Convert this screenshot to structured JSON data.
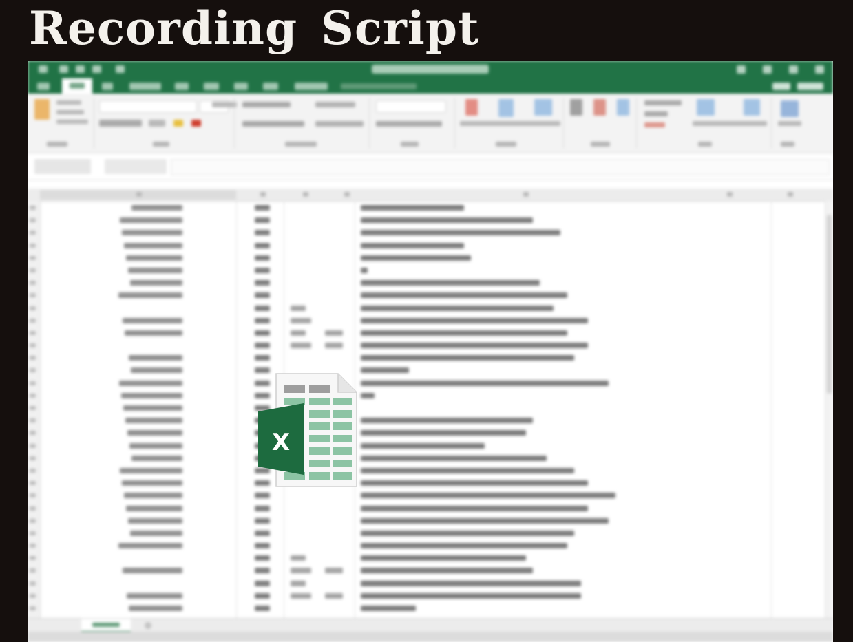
{
  "slide": {
    "title": "Recording Script"
  },
  "app": {
    "name": "Microsoft Excel",
    "icon_letter": "X"
  },
  "colors": {
    "excel_green": "#217346",
    "slide_background": "#150f0d",
    "title_text": "#f4f1ec"
  }
}
